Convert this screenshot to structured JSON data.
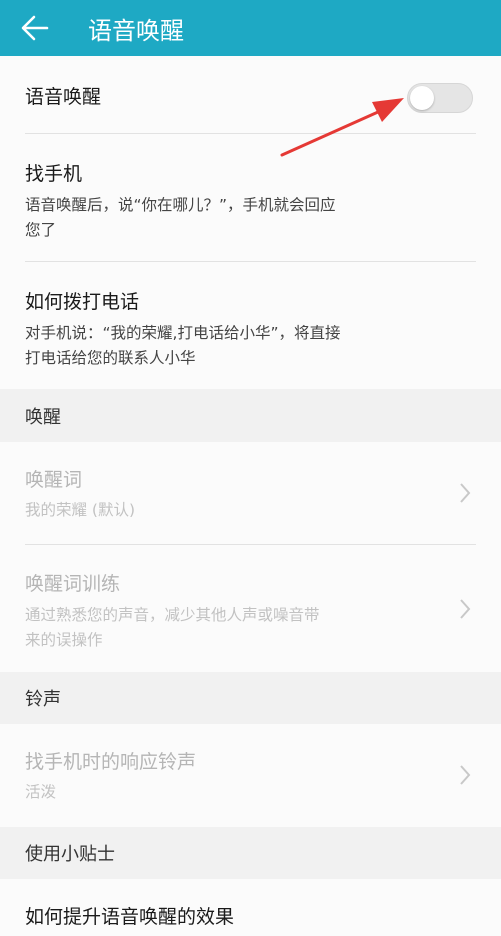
{
  "header": {
    "title": "语音唤醒"
  },
  "voice_wake": {
    "label": "语音唤醒"
  },
  "find_phone": {
    "title": "找手机",
    "desc_line1": "语音唤醒后，说“你在哪儿？”，手机就会回应",
    "desc_line2": "您了"
  },
  "call": {
    "title": "如何拨打电话",
    "desc_line1": "对手机说：“我的荣耀,打电话给小华”，将直接",
    "desc_line2": "打电话给您的联系人小华"
  },
  "section_wake": {
    "label": "唤醒"
  },
  "wake_word": {
    "title": "唤醒词",
    "value": "我的荣耀 (默认)"
  },
  "wake_training": {
    "title": "唤醒词训练",
    "desc_line1": "通过熟悉您的声音，减少其他人声或噪音带",
    "desc_line2": "来的误操作"
  },
  "section_ringtone": {
    "label": "铃声"
  },
  "ringtone": {
    "title": "找手机时的响应铃声",
    "value": "活泼"
  },
  "section_tips": {
    "label": "使用小贴士"
  },
  "tips": {
    "title": "如何提升语音唤醒的效果"
  },
  "colors": {
    "header": "#1ea9c4",
    "arrow": "#e53935",
    "background": "#f1f1f1",
    "card": "#fbfbfb"
  },
  "icons": {
    "back": "arrow-left-icon",
    "chevron": "chevron-right-icon",
    "annotation": "red-arrow"
  }
}
